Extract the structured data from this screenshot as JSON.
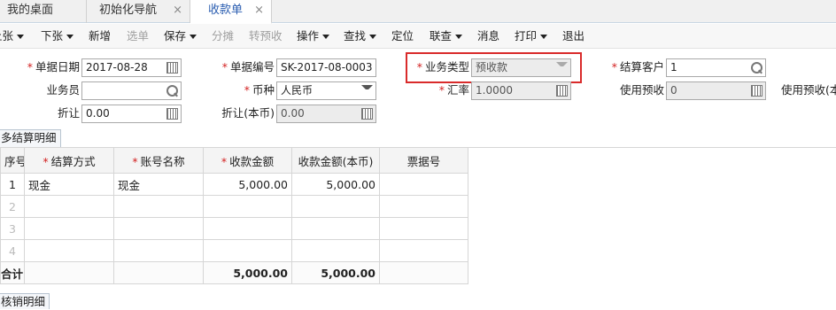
{
  "tabs": [
    {
      "label": "我的桌面"
    },
    {
      "label": "初始化导航",
      "close": "×"
    },
    {
      "label": "收款单",
      "close": "×"
    }
  ],
  "toolbar": {
    "items": [
      {
        "label": "上张",
        "dropdown": true
      },
      {
        "label": "下张",
        "dropdown": true
      },
      {
        "label": "新增"
      },
      {
        "label": "选单",
        "disabled": true
      },
      {
        "label": "保存",
        "dropdown": true
      },
      {
        "label": "分摊",
        "disabled": true
      },
      {
        "label": "转预收",
        "disabled": true
      },
      {
        "label": "操作",
        "dropdown": true
      },
      {
        "label": "查找",
        "dropdown": true
      },
      {
        "label": "定位"
      },
      {
        "label": "联查",
        "dropdown": true
      },
      {
        "label": "消息"
      },
      {
        "label": "打印",
        "dropdown": true
      },
      {
        "label": "退出"
      }
    ]
  },
  "form": {
    "doc_date_label": "单据日期",
    "doc_date_value": "2017-08-28",
    "doc_no_label": "单据编号",
    "doc_no_value": "SK-2017-08-0003",
    "biz_type_label": "业务类型",
    "biz_type_value": "预收款",
    "customer_label": "结算客户",
    "customer_value": "1",
    "salesman_label": "业务员",
    "salesman_value": "",
    "currency_label": "币种",
    "currency_value": "人民币",
    "rate_label": "汇率",
    "rate_value": "1.0000",
    "use_prepay_label": "使用预收",
    "use_prepay_value": "0",
    "use_prepay2_label": "使用预收(本",
    "discount_label": "折让",
    "discount_value": "0.00",
    "discount_local_label": "折让(本币)",
    "discount_local_value": "0.00",
    "required_mark": "*"
  },
  "sections": {
    "settle_detail": "多结算明细",
    "writeoff_detail": "核销明细"
  },
  "grid": {
    "headers": [
      "序号",
      "结算方式",
      "账号名称",
      "收款金额",
      "收款金额(本币)",
      "票据号"
    ],
    "rows": [
      {
        "idx": "1",
        "method": "现金",
        "account": "现金",
        "amount": "5,000.00",
        "amount_local": "5,000.00",
        "bill_no": ""
      },
      {
        "idx": "2",
        "method": "",
        "account": "",
        "amount": "",
        "amount_local": "",
        "bill_no": ""
      },
      {
        "idx": "3",
        "method": "",
        "account": "",
        "amount": "",
        "amount_local": "",
        "bill_no": ""
      },
      {
        "idx": "4",
        "method": "",
        "account": "",
        "amount": "",
        "amount_local": "",
        "bill_no": ""
      }
    ],
    "total_label": "合计",
    "total_amount": "5,000.00",
    "total_amount_local": "5,000.00"
  }
}
